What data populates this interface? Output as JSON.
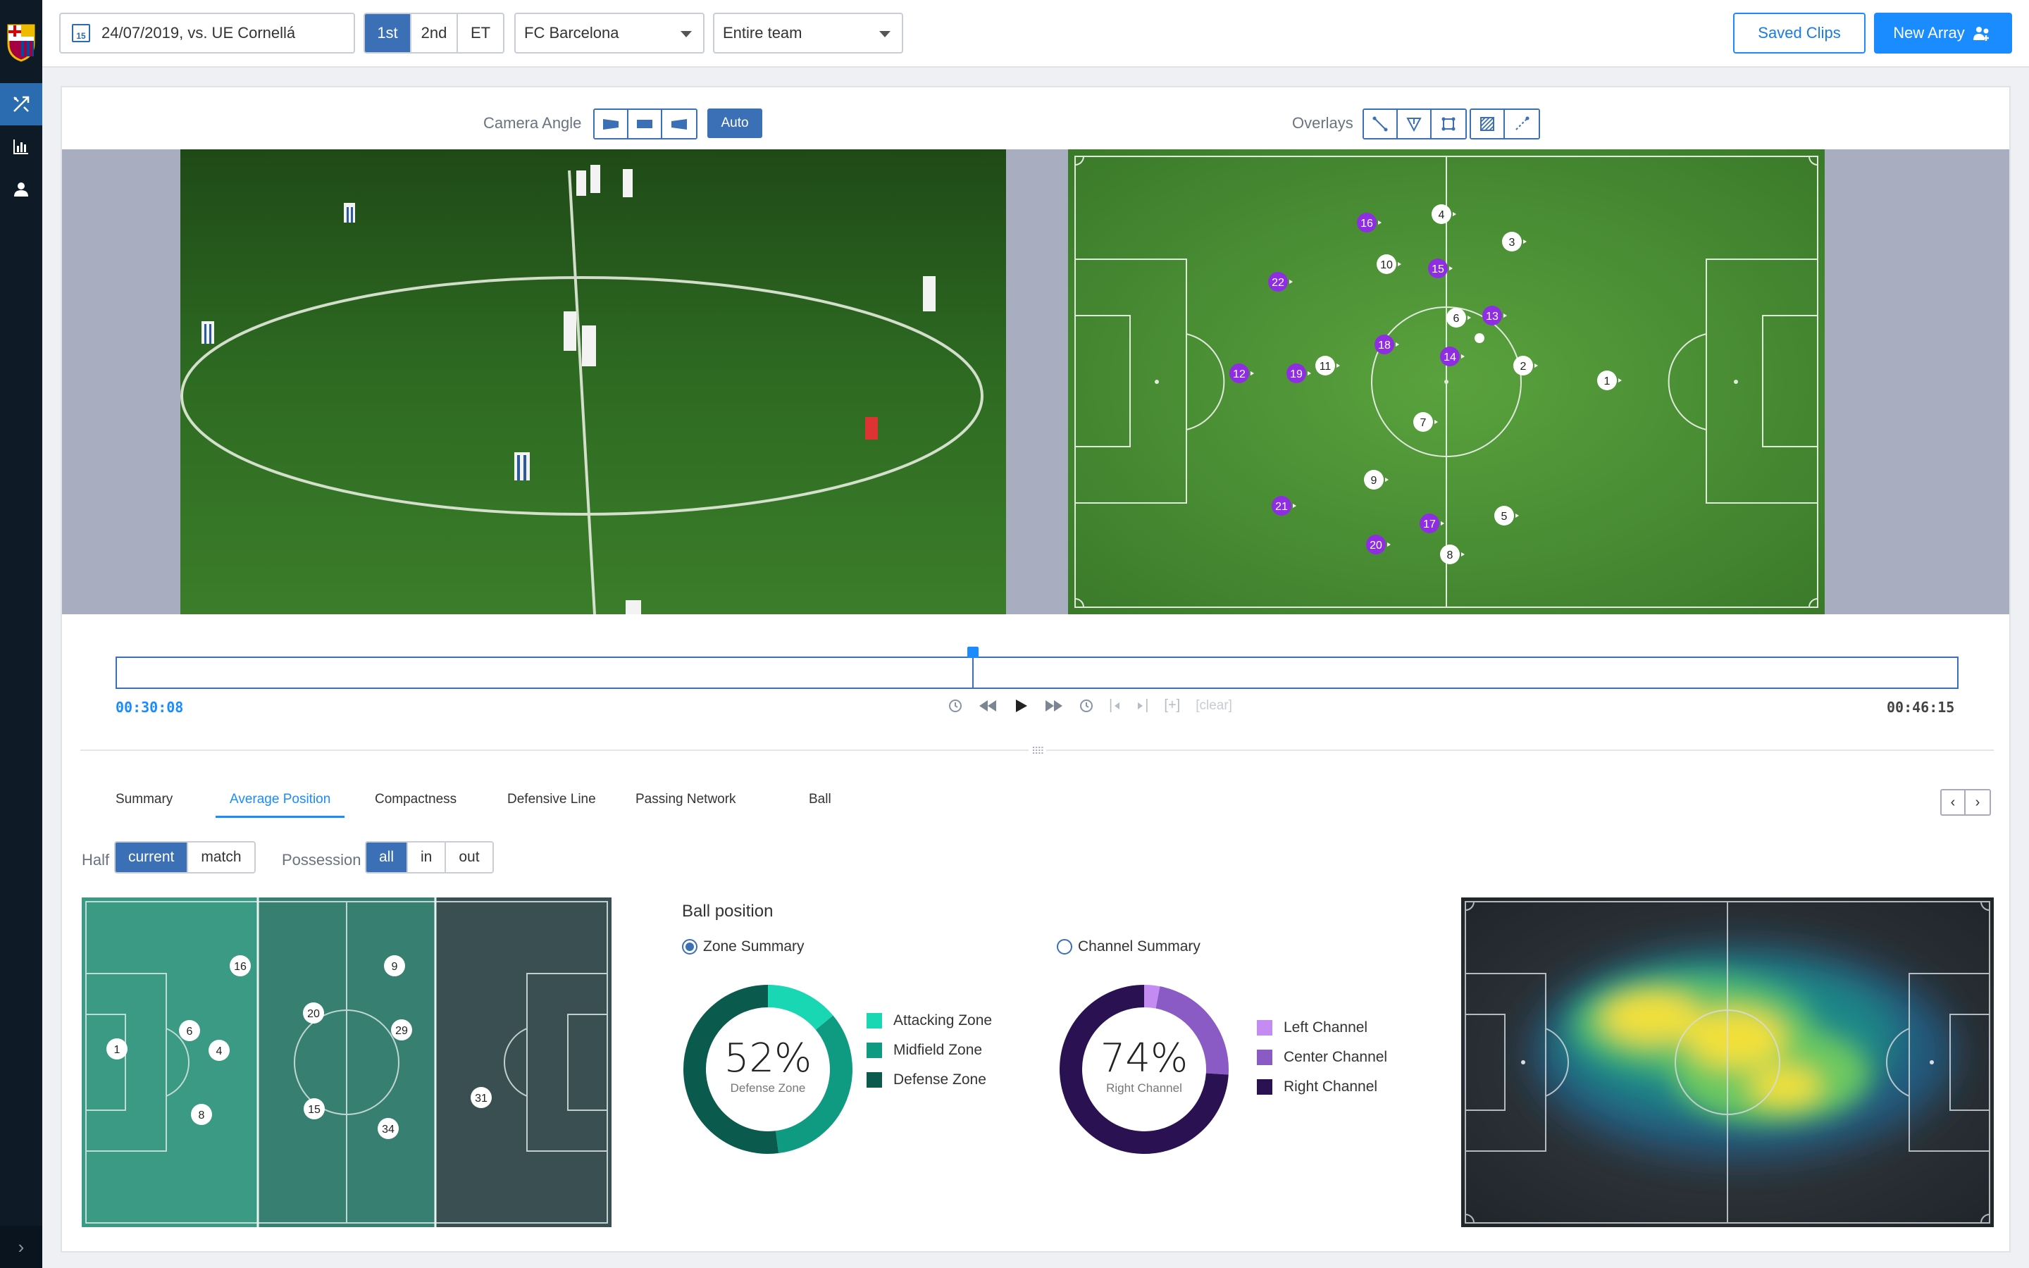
{
  "topbar": {
    "date_value": "24/07/2019, vs. UE Cornellá",
    "calendar_day": "15",
    "half_tabs": [
      "1st",
      "2nd",
      "ET"
    ],
    "half_selected": "1st",
    "team_select": "FC Barcelona",
    "scope_select": "Entire team",
    "saved_clips_label": "Saved Clips",
    "new_array_label": "New Array"
  },
  "controls": {
    "camera_angle_label": "Camera Angle",
    "auto_label": "Auto",
    "overlays_label": "Overlays"
  },
  "timeline": {
    "start_time": "00:30:08",
    "end_time": "00:46:15",
    "clear_label": "[clear]",
    "playhead_fraction": 0.465
  },
  "pitch_players": {
    "purple": [
      "16",
      "22",
      "15",
      "13",
      "18",
      "14",
      "12",
      "19",
      "21",
      "17",
      "20"
    ],
    "white": [
      "4",
      "10",
      "3",
      "6",
      "11",
      "2",
      "1",
      "7",
      "9",
      "5",
      "8"
    ]
  },
  "analysis_tabs": [
    "Summary",
    "Average Position",
    "Compactness",
    "Defensive Line",
    "Passing Network",
    "Ball"
  ],
  "analysis_tab_selected": "Average Position",
  "filters": {
    "half_label": "Half",
    "half_options": [
      "current",
      "match"
    ],
    "half_selected": "current",
    "possession_label": "Possession",
    "possession_options": [
      "all",
      "in",
      "out"
    ],
    "possession_selected": "all"
  },
  "average_positions": [
    "1",
    "16",
    "6",
    "4",
    "8",
    "9",
    "20",
    "29",
    "15",
    "31",
    "34"
  ],
  "ball_position": {
    "title": "Ball position",
    "zone_radio": "Zone Summary",
    "channel_radio": "Channel Summary",
    "zone_selected": true,
    "zone": {
      "percent": "52%",
      "caption": "Defense Zone",
      "legend": [
        "Attacking Zone",
        "Midfield Zone",
        "Defense Zone"
      ],
      "colors": [
        "#19d7b3",
        "#0f9a82",
        "#0b5a4e"
      ],
      "values": [
        0.14,
        0.34,
        0.52
      ]
    },
    "channel": {
      "percent": "74%",
      "caption": "Right Channel",
      "legend": [
        "Left Channel",
        "Center Channel",
        "Right Channel"
      ],
      "colors": [
        "#c48cf2",
        "#8a5bc4",
        "#2a1252"
      ],
      "values": [
        0.03,
        0.23,
        0.74
      ]
    }
  }
}
